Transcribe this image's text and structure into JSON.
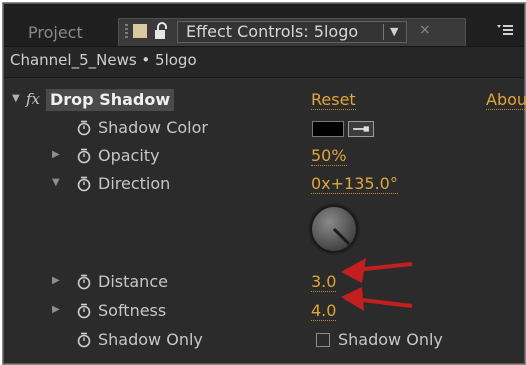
{
  "tabs": {
    "project_label": "Project",
    "active_title": "Effect Controls: 5logo"
  },
  "breadcrumb": "Channel_5_News • 5logo",
  "effect": {
    "name": "Drop Shadow",
    "reset_label": "Reset",
    "about_label": "Abou"
  },
  "properties": [
    {
      "label": "Shadow Color",
      "value": ""
    },
    {
      "label": "Opacity",
      "value": "50%"
    },
    {
      "label": "Direction",
      "value": "0x+135.0°"
    },
    {
      "label": "Distance",
      "value": "3.0"
    },
    {
      "label": "Softness",
      "value": "4.0"
    },
    {
      "label": "Shadow Only",
      "value": "Shadow Only"
    }
  ],
  "colors": {
    "accent_value": "#e1a53a",
    "annotation_arrow": "#c31f1f",
    "shadow_color": "#000000"
  },
  "icons": [
    "grip-icon",
    "color-square-icon",
    "lock-icon",
    "dropdown-arrow-icon",
    "close-icon",
    "panel-menu-icon",
    "fx-icon",
    "stopwatch-icon",
    "twisty-icon",
    "eyedropper-icon",
    "dial-icon",
    "annotation-arrow-icon"
  ]
}
